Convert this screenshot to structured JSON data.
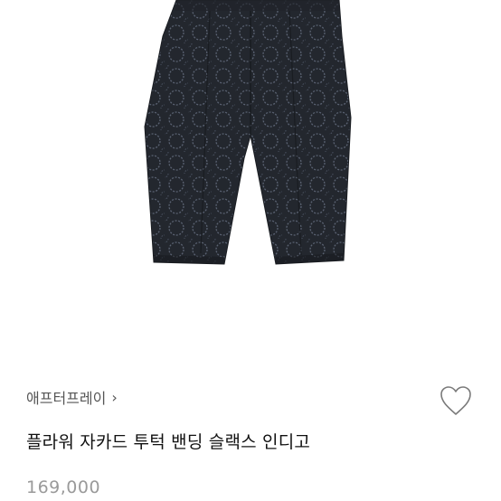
{
  "product": {
    "brand": "애프터프레이",
    "title": "플라워 자카드 투턱 밴딩 슬랙스 인디고",
    "price": "169,000"
  },
  "icons": {
    "brand_chevron": "chevron-right-icon",
    "wishlist": "heart-outline-icon"
  },
  "colors": {
    "fabric": "#22262d",
    "pattern": "#5a6272",
    "text_primary": "#111111",
    "text_secondary": "#555555",
    "price": "#9a9a9a"
  }
}
